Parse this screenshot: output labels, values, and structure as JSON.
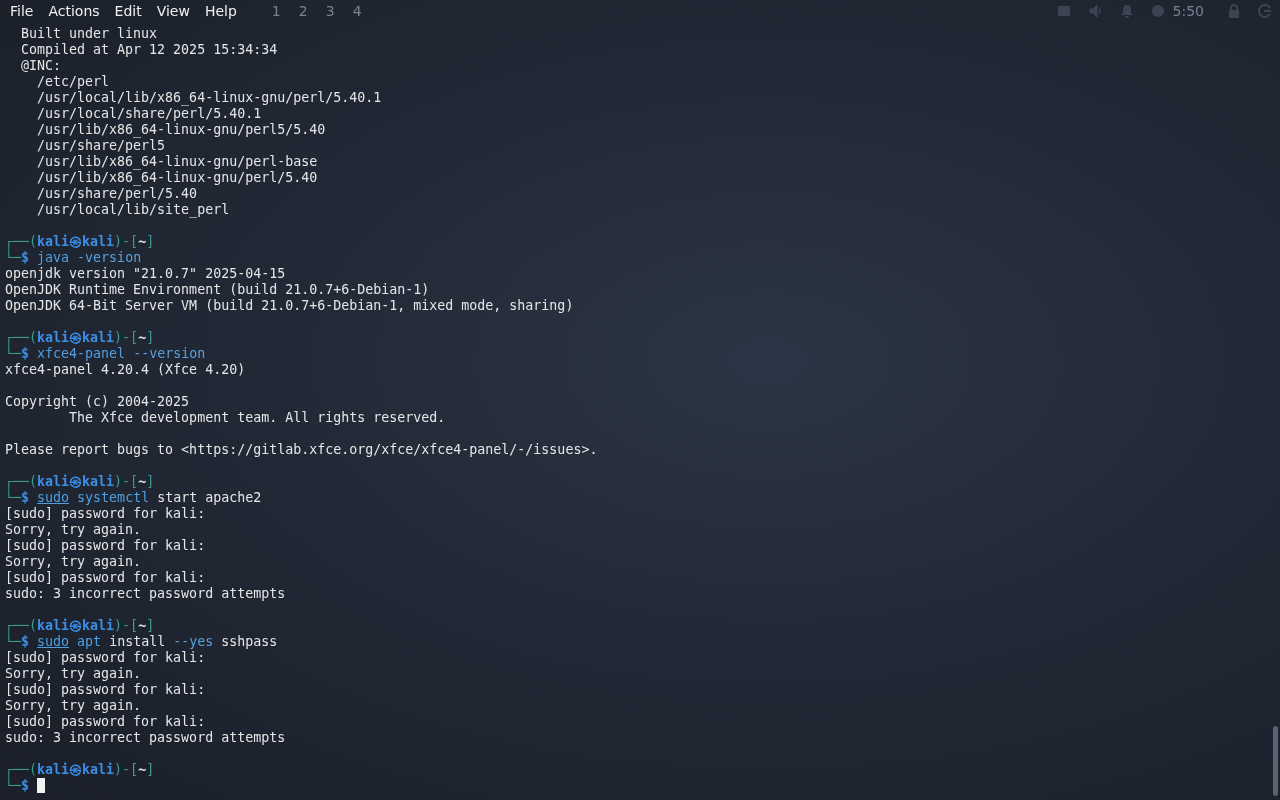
{
  "menu": [
    "File",
    "Actions",
    "Edit",
    "View",
    "Help"
  ],
  "panel": {
    "workspaces": [
      "1",
      "2",
      "3",
      "4"
    ],
    "clock": "5:50"
  },
  "lines": [
    {
      "kind": "output",
      "text": "  Built under linux"
    },
    {
      "kind": "output",
      "text": "  Compiled at Apr 12 2025 15:34:34"
    },
    {
      "kind": "output",
      "text": "  @INC:"
    },
    {
      "kind": "output",
      "text": "    /etc/perl"
    },
    {
      "kind": "output",
      "text": "    /usr/local/lib/x86_64-linux-gnu/perl/5.40.1"
    },
    {
      "kind": "output",
      "text": "    /usr/local/share/perl/5.40.1"
    },
    {
      "kind": "output",
      "text": "    /usr/lib/x86_64-linux-gnu/perl5/5.40"
    },
    {
      "kind": "output",
      "text": "    /usr/share/perl5"
    },
    {
      "kind": "output",
      "text": "    /usr/lib/x86_64-linux-gnu/perl-base"
    },
    {
      "kind": "output",
      "text": "    /usr/lib/x86_64-linux-gnu/perl/5.40"
    },
    {
      "kind": "output",
      "text": "    /usr/share/perl/5.40"
    },
    {
      "kind": "output",
      "text": "    /usr/local/lib/site_perl"
    },
    {
      "kind": "blank"
    },
    {
      "kind": "prompt",
      "open": "┌──(",
      "user": "kali",
      "sep": "㉿",
      "host": "kali",
      "mid": ")-[",
      "dir": "~",
      "close": "]",
      "lead": "└─$",
      "command": [
        {
          "text": "java",
          "kind": "command"
        },
        {
          "text": "-version",
          "kind": "option"
        }
      ]
    },
    {
      "kind": "output",
      "text": "openjdk version \"21.0.7\" 2025-04-15"
    },
    {
      "kind": "output",
      "text": "OpenJDK Runtime Environment (build 21.0.7+6-Debian-1)"
    },
    {
      "kind": "output",
      "text": "OpenJDK 64-Bit Server VM (build 21.0.7+6-Debian-1, mixed mode, sharing)"
    },
    {
      "kind": "blank"
    },
    {
      "kind": "prompt",
      "open": "┌──(",
      "user": "kali",
      "sep": "㉿",
      "host": "kali",
      "mid": ")-[",
      "dir": "~",
      "close": "]",
      "lead": "└─$",
      "command": [
        {
          "text": "xfce4-panel",
          "kind": "command"
        },
        {
          "text": "--version",
          "kind": "option"
        }
      ]
    },
    {
      "kind": "output",
      "text": "xfce4-panel 4.20.4 (Xfce 4.20)"
    },
    {
      "kind": "blank"
    },
    {
      "kind": "output",
      "text": "Copyright (c) 2004-2025"
    },
    {
      "kind": "output",
      "text": "        The Xfce development team. All rights reserved."
    },
    {
      "kind": "blank"
    },
    {
      "kind": "output",
      "text": "Please report bugs to <https://gitlab.xfce.org/xfce/xfce4-panel/-/issues>."
    },
    {
      "kind": "blank"
    },
    {
      "kind": "prompt",
      "open": "┌──(",
      "user": "kali",
      "sep": "㉿",
      "host": "kali",
      "mid": ")-[",
      "dir": "~",
      "close": "]",
      "lead": "└─$",
      "command": [
        {
          "text": "sudo",
          "kind": "sudo"
        },
        {
          "text": "systemctl",
          "kind": "command"
        },
        {
          "text": "start apache2",
          "kind": "plain"
        }
      ]
    },
    {
      "kind": "output",
      "text": "[sudo] password for kali:"
    },
    {
      "kind": "output",
      "text": "Sorry, try again."
    },
    {
      "kind": "output",
      "text": "[sudo] password for kali:"
    },
    {
      "kind": "output",
      "text": "Sorry, try again."
    },
    {
      "kind": "output",
      "text": "[sudo] password for kali:"
    },
    {
      "kind": "output",
      "text": "sudo: 3 incorrect password attempts"
    },
    {
      "kind": "blank"
    },
    {
      "kind": "prompt",
      "open": "┌──(",
      "user": "kali",
      "sep": "㉿",
      "host": "kali",
      "mid": ")-[",
      "dir": "~",
      "close": "]",
      "lead": "└─$",
      "command": [
        {
          "text": "sudo",
          "kind": "sudo"
        },
        {
          "text": "apt",
          "kind": "command"
        },
        {
          "text": "install",
          "kind": "plain"
        },
        {
          "text": "--yes",
          "kind": "option"
        },
        {
          "text": "sshpass",
          "kind": "plain"
        }
      ]
    },
    {
      "kind": "output",
      "text": "[sudo] password for kali:"
    },
    {
      "kind": "output",
      "text": "Sorry, try again."
    },
    {
      "kind": "output",
      "text": "[sudo] password for kali:"
    },
    {
      "kind": "output",
      "text": "Sorry, try again."
    },
    {
      "kind": "output",
      "text": "[sudo] password for kali:"
    },
    {
      "kind": "output",
      "text": "sudo: 3 incorrect password attempts"
    },
    {
      "kind": "blank"
    },
    {
      "kind": "prompt",
      "open": "┌──(",
      "user": "kali",
      "sep": "㉿",
      "host": "kali",
      "mid": ")-[",
      "dir": "~",
      "close": "]",
      "lead": "└─$",
      "cursor": true
    }
  ]
}
